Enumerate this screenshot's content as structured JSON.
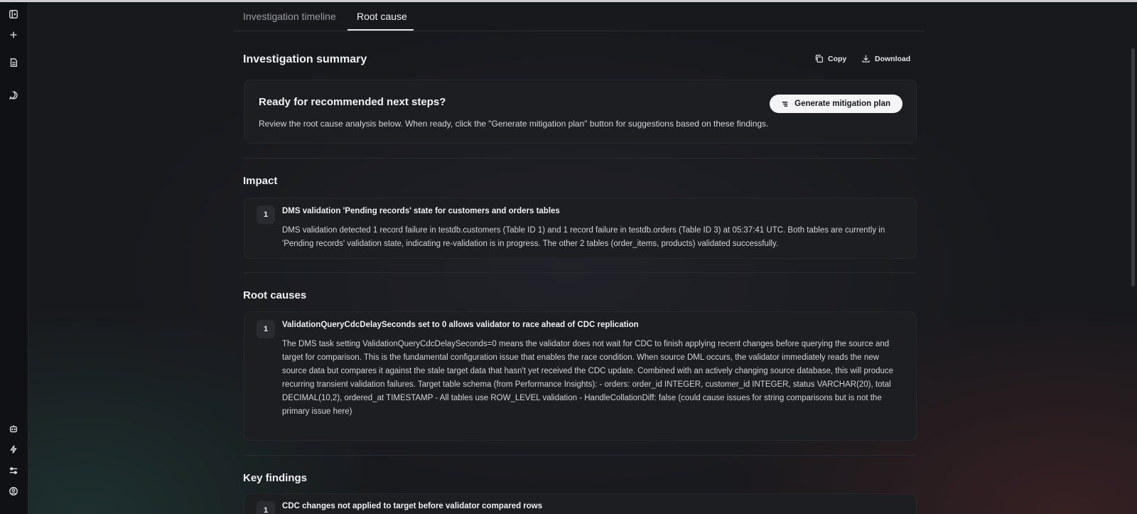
{
  "tabs": [
    {
      "label": "Investigation timeline"
    },
    {
      "label": "Root cause"
    }
  ],
  "summary": {
    "title": "Investigation summary",
    "copy_label": "Copy",
    "download_label": "Download"
  },
  "ready": {
    "title": "Ready for recommended next steps?",
    "text": "Review the root cause analysis below. When ready, click the \"Generate mitigation plan\" button for suggestions based on these findings.",
    "button_label": "Generate mitigation plan"
  },
  "impact": {
    "title": "Impact",
    "items": [
      {
        "number": "1",
        "title": "DMS validation 'Pending records' state for customers and orders tables",
        "body": "DMS validation detected 1 record failure in testdb.customers (Table ID 1) and 1 record failure in testdb.orders (Table ID 3) at 05:37:41 UTC. Both tables are currently in 'Pending records' validation state, indicating re-validation is in progress. The other 2 tables (order_items, products) validated successfully."
      }
    ]
  },
  "root_causes": {
    "title": "Root causes",
    "items": [
      {
        "number": "1",
        "title": "ValidationQueryCdcDelaySeconds set to 0 allows validator to race ahead of CDC replication",
        "body": "The DMS task setting ValidationQueryCdcDelaySeconds=0 means the validator does not wait for CDC to finish applying recent changes before querying the source and target for comparison. This is the fundamental configuration issue that enables the race condition. When source DML occurs, the validator immediately reads the new source data but compares it against the stale target data that hasn't yet received the CDC update. Combined with an actively changing source database, this will produce recurring transient validation failures. Target table schema (from Performance Insights): - orders: order_id INTEGER, customer_id INTEGER, status VARCHAR(20), total DECIMAL(10,2), ordered_at TIMESTAMP - All tables use ROW_LEVEL validation - HandleCollationDiff: false (could cause issues for string comparisons but is not the primary issue here)"
      }
    ]
  },
  "key_findings": {
    "title": "Key findings",
    "items": [
      {
        "number": "1",
        "title": "CDC changes not applied to target before validator compared rows"
      }
    ]
  },
  "rail_icons": [
    "sidebar-toggle-icon",
    "plus-icon",
    "document-icon",
    "chat-icon",
    "bot-icon",
    "lightning-icon",
    "sliders-icon",
    "user-circle-icon"
  ]
}
